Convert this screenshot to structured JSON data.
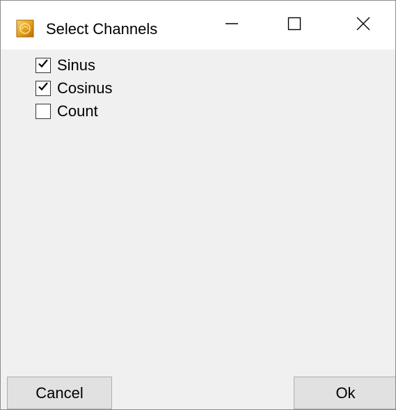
{
  "window": {
    "title": "Select Channels"
  },
  "titlebar": {
    "app_icon": "orange-app-icon",
    "minimize_icon": "minimize-icon",
    "maximize_icon": "maximize-icon",
    "close_icon": "close-icon"
  },
  "channels": [
    {
      "label": "Sinus",
      "checked": true
    },
    {
      "label": "Cosinus",
      "checked": true
    },
    {
      "label": "Count",
      "checked": false
    }
  ],
  "buttons": {
    "cancel_label": "Cancel",
    "ok_label": "Ok"
  },
  "colors": {
    "titlebar_bg": "#ffffff",
    "client_bg": "#f0f0f0",
    "button_bg": "#e1e1e1",
    "icon_accent": "#e8a317"
  }
}
